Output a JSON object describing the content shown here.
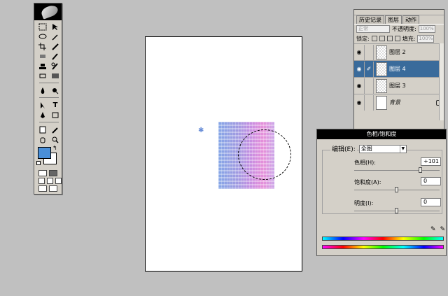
{
  "toolbox": {
    "tools": [
      "marquee-icon",
      "move-icon",
      "lasso-icon",
      "magic-wand-icon",
      "crop-icon",
      "slice-icon",
      "healing-brush-icon",
      "brush-icon",
      "clone-stamp-icon",
      "history-brush-icon",
      "eraser-icon",
      "gradient-icon",
      "blur-icon",
      "dodge-icon",
      "path-selection-icon",
      "type-icon",
      "pen-icon",
      "shape-icon",
      "notes-icon",
      "eyedropper-icon",
      "hand-icon",
      "zoom-icon"
    ],
    "type_glyph": "T",
    "foreground_color": "#4a8fd8",
    "background_color": "#ffffff"
  },
  "layers_panel": {
    "tabs": [
      "历史记录",
      "图层",
      "动作"
    ],
    "active_tab": "图层",
    "blend_mode": "正常",
    "opacity_label": "不透明度:",
    "opacity_value": "100%",
    "lock_label": "锁定:",
    "fill_label": "填充:",
    "fill_value": "100%",
    "layers": [
      {
        "name": "图层 2",
        "selected": false,
        "visible": true
      },
      {
        "name": "图层 4",
        "selected": true,
        "visible": true
      },
      {
        "name": "图层 3",
        "selected": false,
        "visible": true
      },
      {
        "name": "背景",
        "selected": false,
        "visible": true,
        "locked": true
      }
    ]
  },
  "hue_sat": {
    "title": "色相/饱和度",
    "edit_label": "编辑(E):",
    "edit_value": "全图",
    "hue_label": "色相(H):",
    "hue_value": "+101",
    "hue_fraction": 0.78,
    "sat_label": "饱和度(A):",
    "sat_value": "0",
    "sat_fraction": 0.5,
    "light_label": "明度(I):",
    "light_value": "0",
    "light_fraction": 0.5,
    "accent_color": "#3a6b9b"
  }
}
